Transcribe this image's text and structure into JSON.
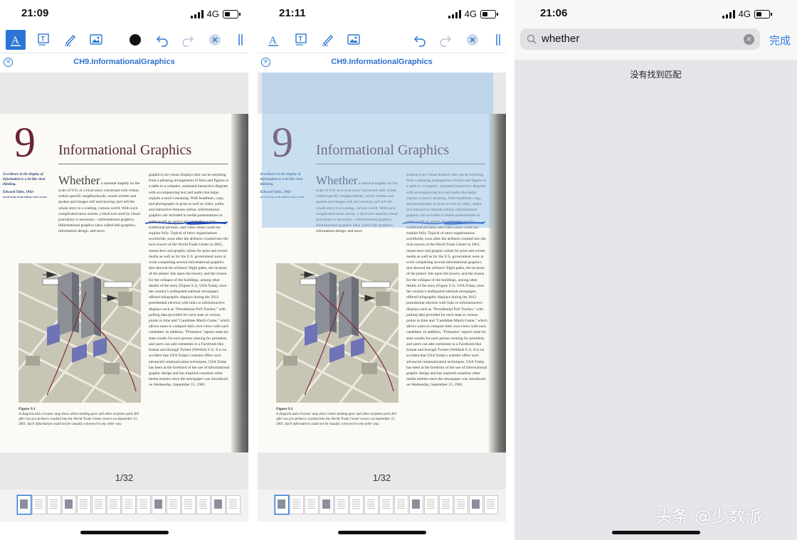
{
  "panels": [
    {
      "time": "21:09",
      "network": "4G",
      "doc_title": "CH9.InformationalGraphics",
      "page_indicator": "1/32"
    },
    {
      "time": "21:11",
      "network": "4G",
      "doc_title": "CH9.InformationalGraphics",
      "page_indicator": "1/32"
    },
    {
      "time": "21:06",
      "network": "4G",
      "search_query": "whether",
      "done_label": "完成",
      "no_match": "没有找到匹配"
    }
  ],
  "pdf_page": {
    "chapter_number": "9",
    "chapter_title": "Informational Graphics",
    "quote": "Excellence in the display of information is a lot like clear thinking.",
    "quote_author": "Edward Tufte, 1942–",
    "quote_role": "DESIGNER, PUBLISHER, EDUCATOR",
    "lead_word": "Whether",
    "col1_text": "a national tragedy on the scale of 9/11 or a local story concerned with crimes within specific neighborhoods, words written and spoken and images still and moving can't tell the whole story to a waiting, curious world. With such complicated news stories, a third tool used by visual journalists is necessary—informational graphics. Informational graphics (also called info-graphics, information design, and news",
    "col2_text": "graphics) are visual displays that can be anything from a pleasing arrangement of facts and figures in a table to a complex, animated interactive diagram with accompanying text and audio that helps explain a story's meaning. With headlines, copy, and photographs in print as well as video, audio, and interactive features online, informational graphics are included in media presentations in order to tell an aspect of a story that words, traditional pictures, and video alone could not explain fully. Typical of news organizations worldwide, soon after the airliners crashed into the twin towers of the World Trade Center in 2001, researchers and graphic artists for print and screen media as well as for the U.S. government were at work completing several informational graphics that showed the airliners' flight paths, the location of the planes' hits upon the towers, and the reason for the collapse of the buildings, among other details of the story (Figure 9.1). USA Today, once the country's undisputed national newspaper, offered infographic displays during the 2012 presidential election with links to infointeractive displays such as \"Presidential Poll Tracker,\" with polling data provided for each state at various points in time and \"Candidate Match Game,\" which allows users to compare their own views with each candidate. In addition, \"Primaries\" reports state-by-state results for each person running for president, and users can add comments in a Facebook-like format and through Twitter (Weblink 9.1). It is no accident that USA Today's website offers such advanced communication techniques. USA Today has been at the forefront of the use of informational graphic design and has inspired countless other media entities since the newspaper was introduced on Wednesday, September 15, 1982.",
    "figure_label": "Figure 9.1",
    "figure_caption": "A diagram and a locator map show where landing gear and other airplane parts fell after two jet airliners crashed into the World Trade Center towers on September 11, 2001. Such information could not be visually conveyed in any other way."
  },
  "watermark": "头条 @少数派",
  "colors": {
    "accent": "#2f78d2",
    "chapter": "#6b2434",
    "selection": "#8cbeeb"
  }
}
